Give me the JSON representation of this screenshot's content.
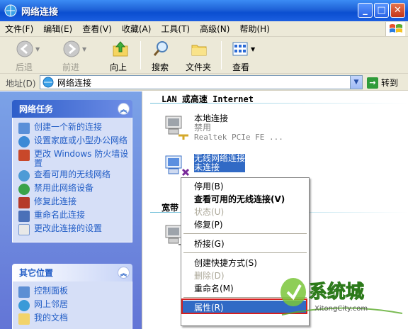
{
  "window": {
    "title": "网络连接"
  },
  "menubar": {
    "items": [
      "文件(F)",
      "编辑(E)",
      "查看(V)",
      "收藏(A)",
      "工具(T)",
      "高级(N)",
      "帮助(H)"
    ]
  },
  "toolbar": {
    "back": "后退",
    "forward": "前进",
    "up": "向上",
    "search": "搜索",
    "folders": "文件夹",
    "view": "查看"
  },
  "address": {
    "label": "地址(D)",
    "value": "网络连接",
    "go": "转到"
  },
  "network_tasks": {
    "title": "网络任务",
    "items": [
      "创建一个新的连接",
      "设置家庭或小型办公网络",
      "更改 Windows 防火墙设置",
      "查看可用的无线网络",
      "禁用此网络设备",
      "修复此连接",
      "重命名此连接",
      "更改此连接的设置"
    ]
  },
  "other_places": {
    "title": "其它位置",
    "items": [
      "控制面板",
      "网上邻居",
      "我的文档"
    ]
  },
  "content": {
    "group_lan": "LAN 或高速 Internet",
    "group_broadband": "宽带",
    "lan": {
      "name": "本地连接",
      "status": "禁用",
      "device": "Realtek PCIe FE ..."
    },
    "wireless": {
      "name": "无线网络连接",
      "status": "未连接"
    }
  },
  "context_menu": {
    "items": [
      {
        "label": "停用(B)",
        "state": "normal"
      },
      {
        "label": "查看可用的无线连接(V)",
        "state": "bold"
      },
      {
        "label": "状态(U)",
        "state": "disabled"
      },
      {
        "label": "修复(P)",
        "state": "normal"
      },
      {
        "label": "桥接(G)",
        "state": "normal"
      },
      {
        "label": "创建快捷方式(S)",
        "state": "normal"
      },
      {
        "label": "删除(D)",
        "state": "disabled"
      },
      {
        "label": "重命名(M)",
        "state": "normal"
      },
      {
        "label": "属性(R)",
        "state": "highlighted"
      }
    ]
  },
  "watermark": {
    "brand": "系统城",
    "url": "XitongCity.com"
  },
  "colors": {
    "titlebar": "#0a4ed0",
    "task_link": "#215dc6",
    "selection": "#316ac5",
    "highlight_box": "#d51f1f"
  }
}
